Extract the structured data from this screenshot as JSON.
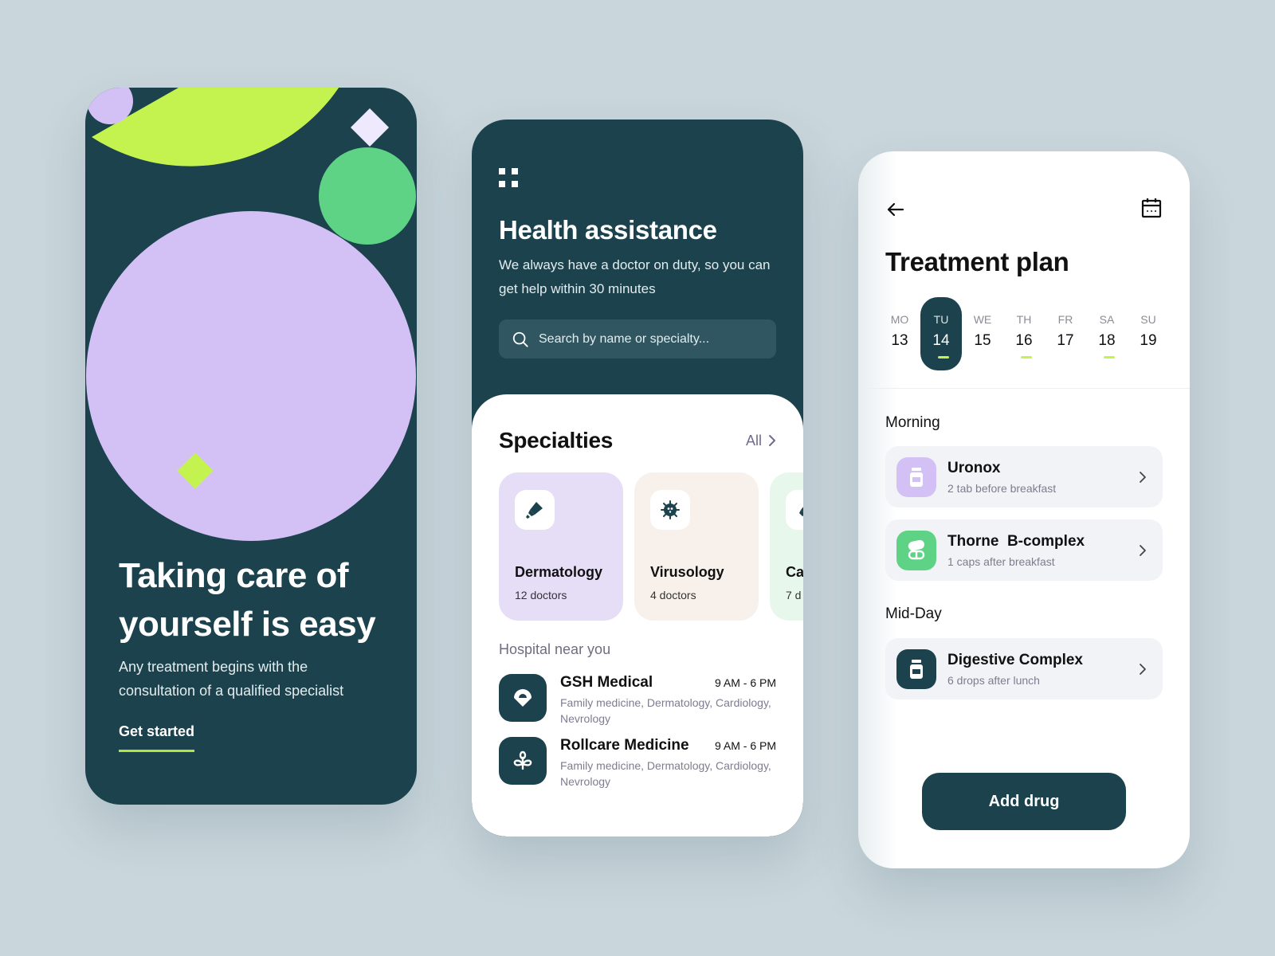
{
  "onboarding": {
    "title_line1": "Taking care of",
    "title_line2": "yourself is easy",
    "subtitle_line1": "Any treatment begins with the",
    "subtitle_line2": "consultation of a qualified specialist",
    "cta": "Get started"
  },
  "home": {
    "menu_icon": "grid-icon",
    "title": "Health assistance",
    "subtitle": "We always have a doctor on duty, so you can get help within 30 minutes",
    "search": {
      "placeholder": "Search by name or specialty...",
      "icon": "search-icon"
    },
    "specialties": {
      "title": "Specialties",
      "all_label": "All",
      "items": [
        {
          "name": "Dermatology",
          "count": "12 doctors",
          "icon": "cream-tube-icon",
          "bg": "#e6ddf7"
        },
        {
          "name": "Virusology",
          "count": "4 doctors",
          "icon": "virus-icon",
          "bg": "#f8f1eb"
        },
        {
          "name": "Ca",
          "count": "7 d",
          "icon": "cream-tube-icon",
          "bg": "#e8f7ec"
        }
      ]
    },
    "hospitals": {
      "title": "Hospital near you",
      "items": [
        {
          "name": "GSH Medical",
          "hours": "9 AM - 6 PM",
          "tags": "Family medicine, Dermatology, Cardiology, Nevrology",
          "icon": "gsh-logo-icon"
        },
        {
          "name": "Rollcare Medicine",
          "hours": "9 AM - 6 PM",
          "tags": "Family medicine, Dermatology, Cardiology, Nevrology",
          "icon": "sprout-logo-icon"
        }
      ]
    }
  },
  "treatment": {
    "title": "Treatment plan",
    "back_icon": "arrow-left-icon",
    "calendar_icon": "calendar-icon",
    "week": [
      {
        "day": "MO",
        "date": "13",
        "active": false,
        "has_dose": false
      },
      {
        "day": "TU",
        "date": "14",
        "active": true,
        "has_dose": true
      },
      {
        "day": "WE",
        "date": "15",
        "active": false,
        "has_dose": false
      },
      {
        "day": "TH",
        "date": "16",
        "active": false,
        "has_dose": true
      },
      {
        "day": "FR",
        "date": "17",
        "active": false,
        "has_dose": false
      },
      {
        "day": "SA",
        "date": "18",
        "active": false,
        "has_dose": true
      },
      {
        "day": "SU",
        "date": "19",
        "active": false,
        "has_dose": false
      }
    ],
    "periods": [
      {
        "label": "Morning",
        "meds": [
          {
            "name": "Uronox",
            "dose": "2 tab before breakfast",
            "icon": "pill-bottle-icon",
            "color": "#d3c1f5"
          },
          {
            "name": "Thorne  B-complex",
            "dose": "1 caps after breakfast",
            "icon": "capsules-icon",
            "color": "#5ed386"
          }
        ]
      },
      {
        "label": "Mid-Day",
        "meds": [
          {
            "name": "Digestive Complex",
            "dose": "6 drops after lunch",
            "icon": "pill-bottle-icon",
            "color": "#1b424d"
          }
        ]
      }
    ],
    "add_button": "Add drug"
  },
  "colors": {
    "brand_dark": "#1b424d",
    "lime": "#c4f34f",
    "lavender": "#d3c1f5",
    "green": "#5ed386",
    "background": "#c9d6dc"
  }
}
